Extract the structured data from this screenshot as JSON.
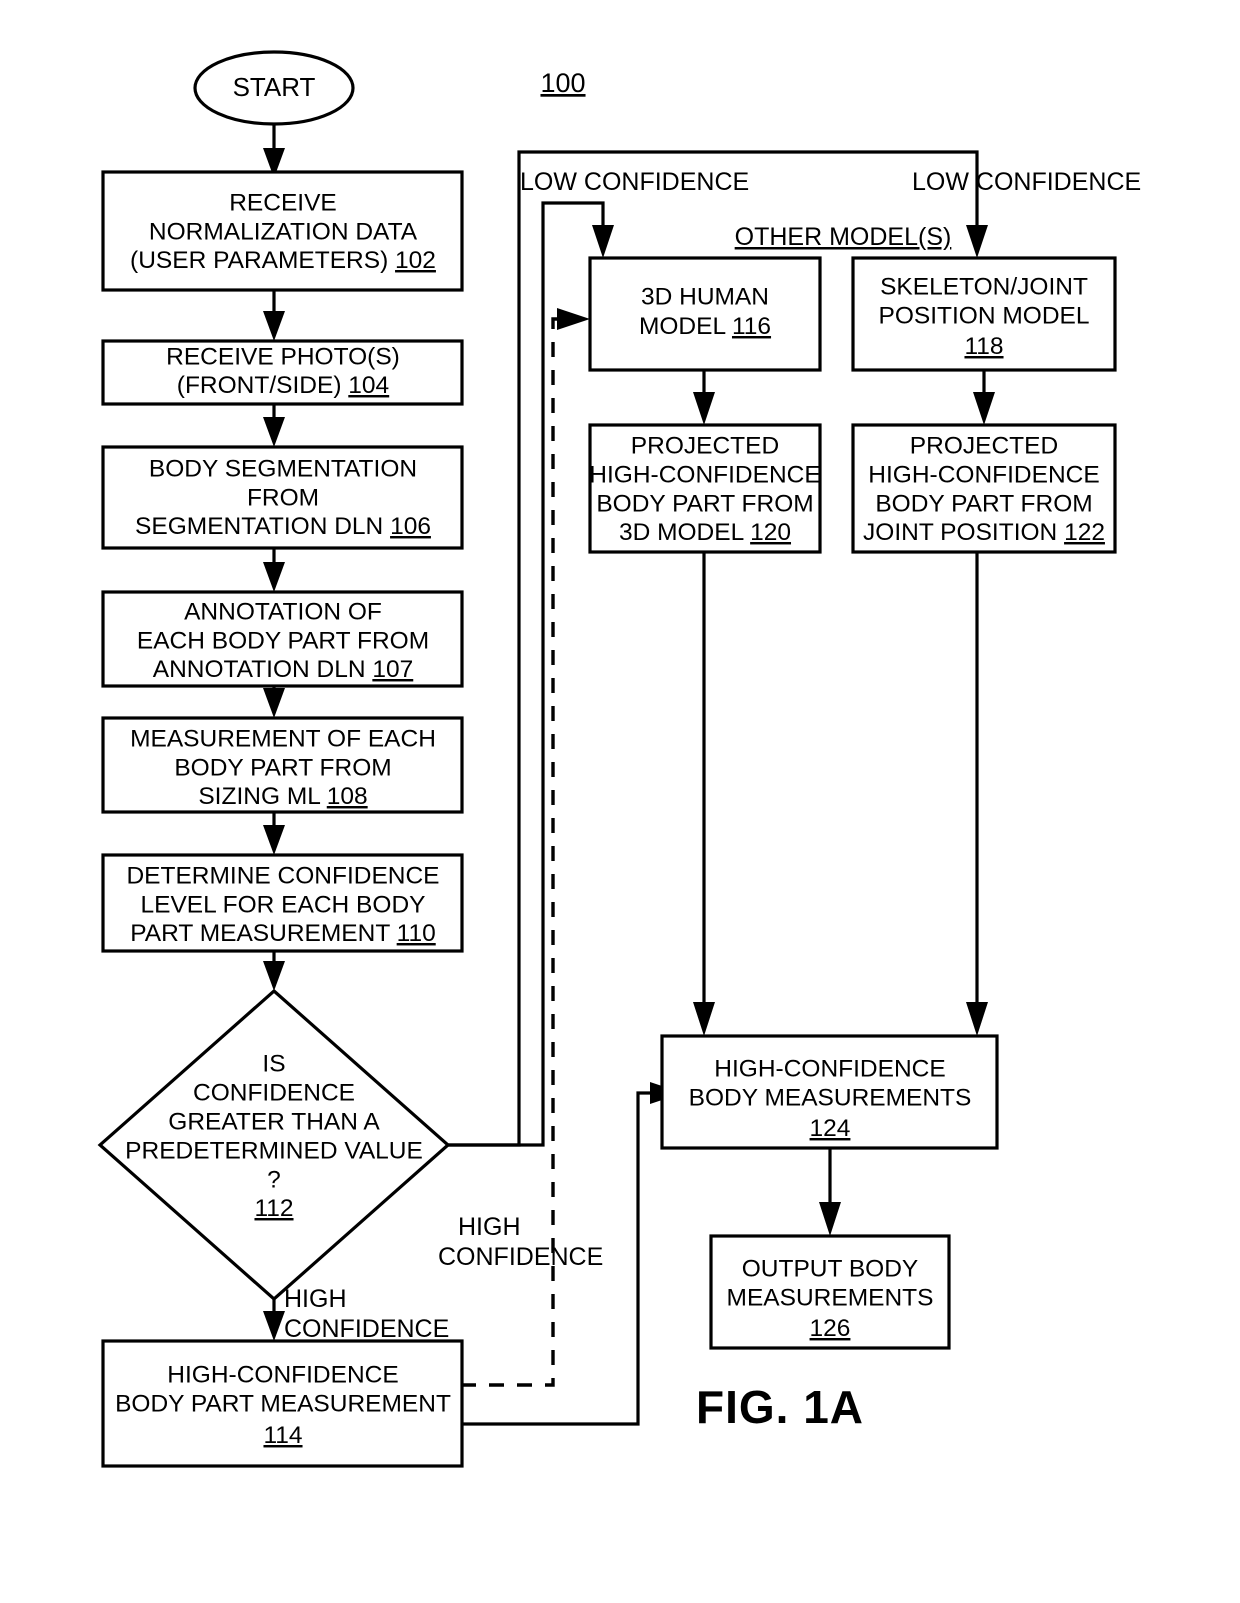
{
  "figure": {
    "caption": "FIG. 1A",
    "number": "100"
  },
  "nodes": {
    "start": {
      "label": "START",
      "shape": "ellipse"
    },
    "n102": {
      "lines": [
        "RECEIVE",
        "NORMALIZATION DATA",
        "(USER PARAMETERS) 102"
      ],
      "ref": "102",
      "shape": "process"
    },
    "n104": {
      "lines": [
        "RECEIVE PHOTO(S)",
        "(FRONT/SIDE) 104"
      ],
      "ref": "104",
      "shape": "process"
    },
    "n106": {
      "lines": [
        "BODY SEGMENTATION",
        "FROM",
        "SEGMENTATION DLN 106"
      ],
      "ref": "106",
      "shape": "process"
    },
    "n107": {
      "lines": [
        "ANNOTATION OF",
        "EACH BODY PART FROM",
        "ANNOTATION DLN 107"
      ],
      "ref": "107",
      "shape": "process"
    },
    "n108": {
      "lines": [
        "MEASUREMENT OF EACH",
        "BODY PART FROM",
        "SIZING ML 108"
      ],
      "ref": "108",
      "shape": "process"
    },
    "n110": {
      "lines": [
        "DETERMINE CONFIDENCE",
        "LEVEL FOR EACH BODY",
        "PART MEASUREMENT 110"
      ],
      "ref": "110",
      "shape": "process"
    },
    "n112": {
      "lines": [
        "IS",
        "CONFIDENCE",
        "GREATER THAN A",
        "PREDETERMINED VALUE",
        "?",
        "112"
      ],
      "ref": "112",
      "shape": "decision"
    },
    "n114": {
      "lines": [
        "HIGH-CONFIDENCE",
        "BODY PART MEASUREMENT",
        "114"
      ],
      "ref": "114",
      "shape": "process"
    },
    "n116": {
      "lines": [
        "3D HUMAN",
        "MODEL 116"
      ],
      "ref": "116",
      "shape": "process"
    },
    "n118": {
      "lines": [
        "SKELETON/JOINT",
        "POSITION MODEL",
        "118"
      ],
      "ref": "118",
      "shape": "process"
    },
    "n120": {
      "lines": [
        "PROJECTED",
        "HIGH-CONFIDENCE",
        "BODY PART FROM",
        "3D MODEL 120"
      ],
      "ref": "120",
      "shape": "process"
    },
    "n122": {
      "lines": [
        "PROJECTED",
        "HIGH-CONFIDENCE",
        "BODY PART FROM",
        "JOINT POSITION 122"
      ],
      "ref": "122",
      "shape": "process"
    },
    "n124": {
      "lines": [
        "HIGH-CONFIDENCE",
        "BODY MEASUREMENTS",
        "124"
      ],
      "ref": "124",
      "shape": "process"
    },
    "n126": {
      "lines": [
        "OUTPUT BODY",
        "MEASUREMENTS",
        "126"
      ],
      "ref": "126",
      "shape": "process"
    }
  },
  "edge_labels": {
    "low_confidence_left": "LOW CONFIDENCE",
    "low_confidence_right": "LOW CONFIDENCE",
    "other_models": "OTHER MODEL(S)",
    "high_confidence_down_line1": "HIGH",
    "high_confidence_down_line2": "CONFIDENCE",
    "high_confidence_right_line1": "HIGH",
    "high_confidence_right_line2": "CONFIDENCE"
  },
  "colors": {
    "stroke": "#000000",
    "fill": "#ffffff",
    "text": "#000000"
  }
}
